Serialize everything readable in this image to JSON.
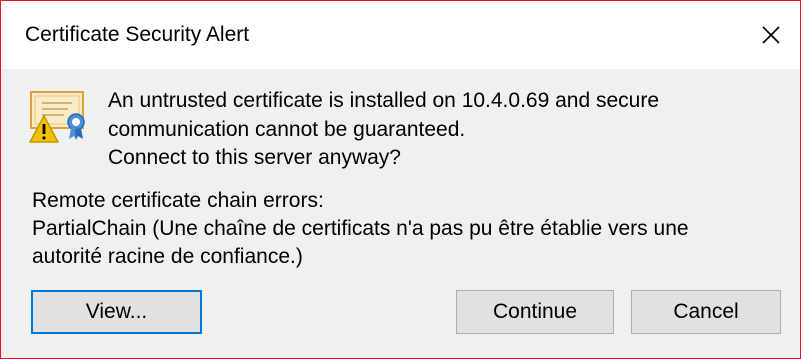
{
  "window": {
    "title": "Certificate Security Alert",
    "close_icon": "close-icon"
  },
  "alert": {
    "icon": "certificate-warning-icon",
    "message_line1": "An untrusted certificate is installed on 10.4.0.69 and secure",
    "message_line2": "communication cannot be guaranteed.",
    "message_line3": "Connect to this server anyway?"
  },
  "errors": {
    "heading": "Remote certificate chain errors:",
    "detail_line1": "PartialChain (Une chaîne de certificats n'a pas pu être établie vers une",
    "detail_line2": "autorité racine de confiance.)"
  },
  "buttons": {
    "view_label": "View...",
    "continue_label": "Continue",
    "cancel_label": "Cancel"
  },
  "colors": {
    "window_border": "#e81123",
    "default_button_border": "#0078d7",
    "dialog_background": "#f0f0f0"
  }
}
